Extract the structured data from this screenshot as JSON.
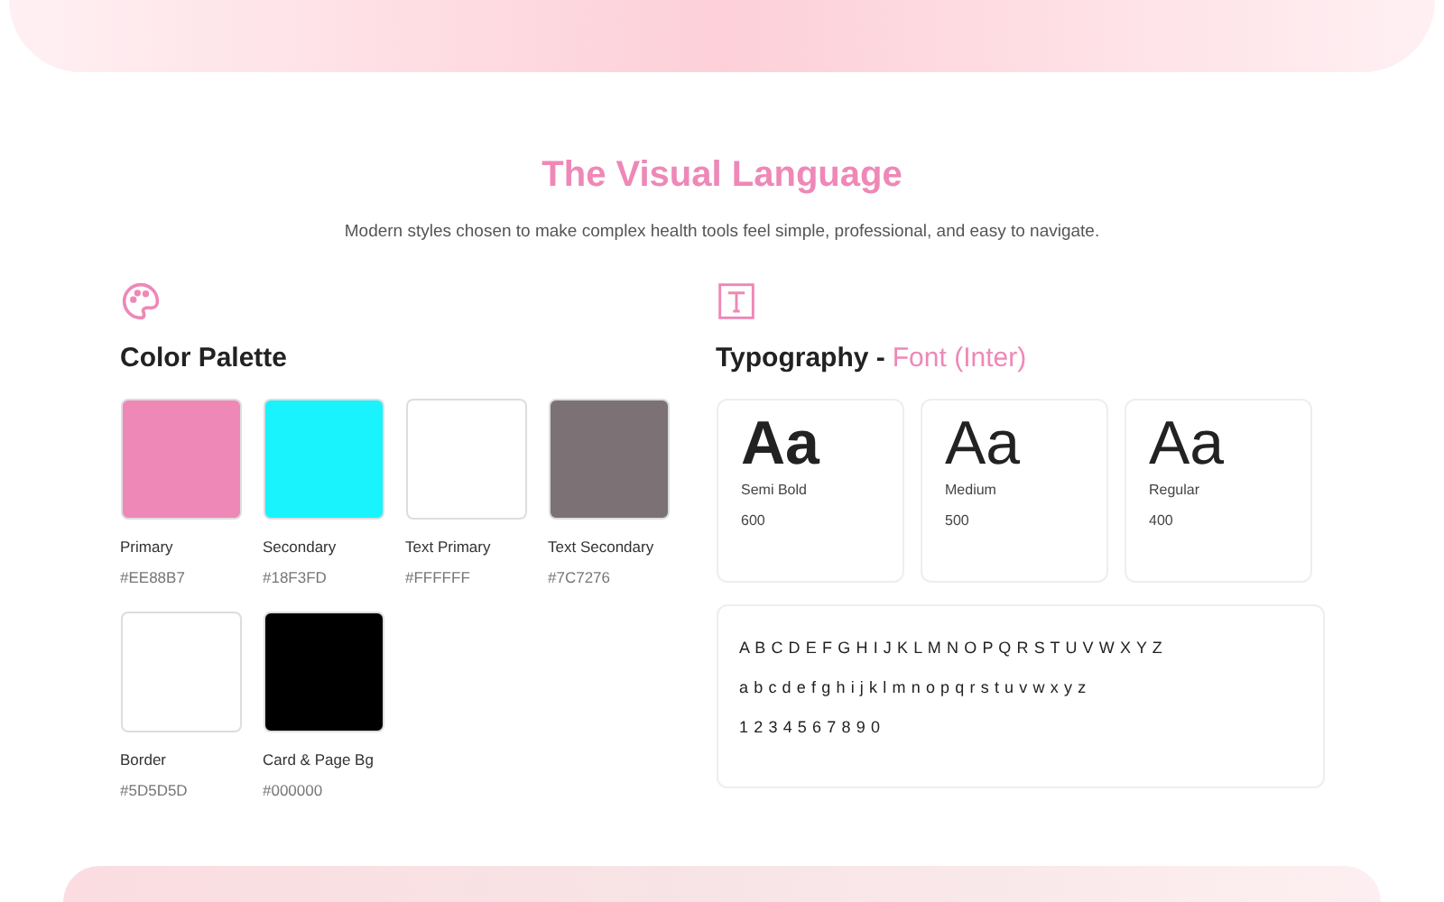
{
  "section": {
    "title": "The Visual Language",
    "subtitle": "Modern styles chosen to make complex health tools feel simple, professional, and easy to navigate."
  },
  "palette": {
    "heading": "Color Palette",
    "colors": [
      {
        "name": "Primary",
        "hex": "#EE88B7",
        "color": "#ee88b7"
      },
      {
        "name": "Secondary",
        "hex": "#18F3FD",
        "color": "#18f3fd"
      },
      {
        "name": "Text Primary",
        "hex": "#FFFFFF",
        "color": "#ffffff"
      },
      {
        "name": "Text Secondary",
        "hex": "#7C7276",
        "color": "#7c7276"
      },
      {
        "name": "Border",
        "hex": "#5D5D5D",
        "color": "#ffffff"
      },
      {
        "name": "Card & Page Bg",
        "hex": "#000000",
        "color": "#000000"
      }
    ]
  },
  "typography": {
    "heading": "Typography -",
    "accent": "Font (Inter)",
    "weights": [
      {
        "sample": "Aa",
        "name": "Semi Bold",
        "weight": "600"
      },
      {
        "sample": "Aa",
        "name": "Medium",
        "weight": "500"
      },
      {
        "sample": "Aa",
        "name": "Regular",
        "weight": "400"
      }
    ],
    "alphabet": [
      "A B C D E F G H I J K L M N O P Q R S T U V W X Y Z",
      "a b c d e f g h i j k l m n o p q r s t u v w x y z",
      "1 2 3 4 5 6 7 8 9 0"
    ]
  }
}
